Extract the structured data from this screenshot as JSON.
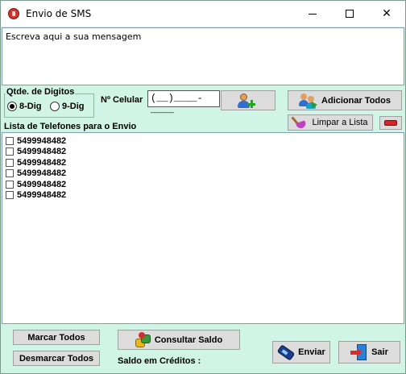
{
  "window": {
    "title": "Envio de SMS",
    "controls": {
      "minimize": "minimize",
      "maximize": "maximize",
      "close": "✕"
    }
  },
  "message": {
    "placeholder": "Escreva aqui a sua mensagem"
  },
  "digits_group": {
    "legend": "Qtde. de Digitos",
    "options": [
      {
        "label": "8-Dig",
        "checked": true
      },
      {
        "label": "9-Dig",
        "checked": false
      }
    ]
  },
  "phone_entry": {
    "label": "Nº Celular",
    "mask_value": "(__)____-____"
  },
  "buttons": {
    "add_contact": "",
    "add_all": "Adicionar Todos",
    "clear_list": "Limpar a Lista",
    "remove": "",
    "mark_all": "Marcar Todos",
    "unmark_all": "Desmarcar Todos",
    "check_balance": "Consultar Saldo",
    "send": "Enviar",
    "exit": "Sair"
  },
  "list": {
    "title": "Lista de Telefones para o Envio",
    "items": [
      {
        "number": "5499948482",
        "checked": false
      },
      {
        "number": "5499948482",
        "checked": false
      },
      {
        "number": "5499948482",
        "checked": false
      },
      {
        "number": "5499948482",
        "checked": false
      },
      {
        "number": "5499948482",
        "checked": false
      },
      {
        "number": "5499948482",
        "checked": false
      }
    ]
  },
  "credits": {
    "label": "Saldo em Créditos :"
  },
  "colors": {
    "panel_background": "#d0f4e6",
    "button_face": "#dcdcdc"
  },
  "icons": {
    "app": "sms-app-icon",
    "add_contact": "user-add-icon",
    "add_all": "users-add-all-icon",
    "clear_list": "broom-icon",
    "remove": "minus-icon",
    "check_balance": "coins-icon",
    "send": "cellphone-icon",
    "exit": "exit-door-icon"
  }
}
